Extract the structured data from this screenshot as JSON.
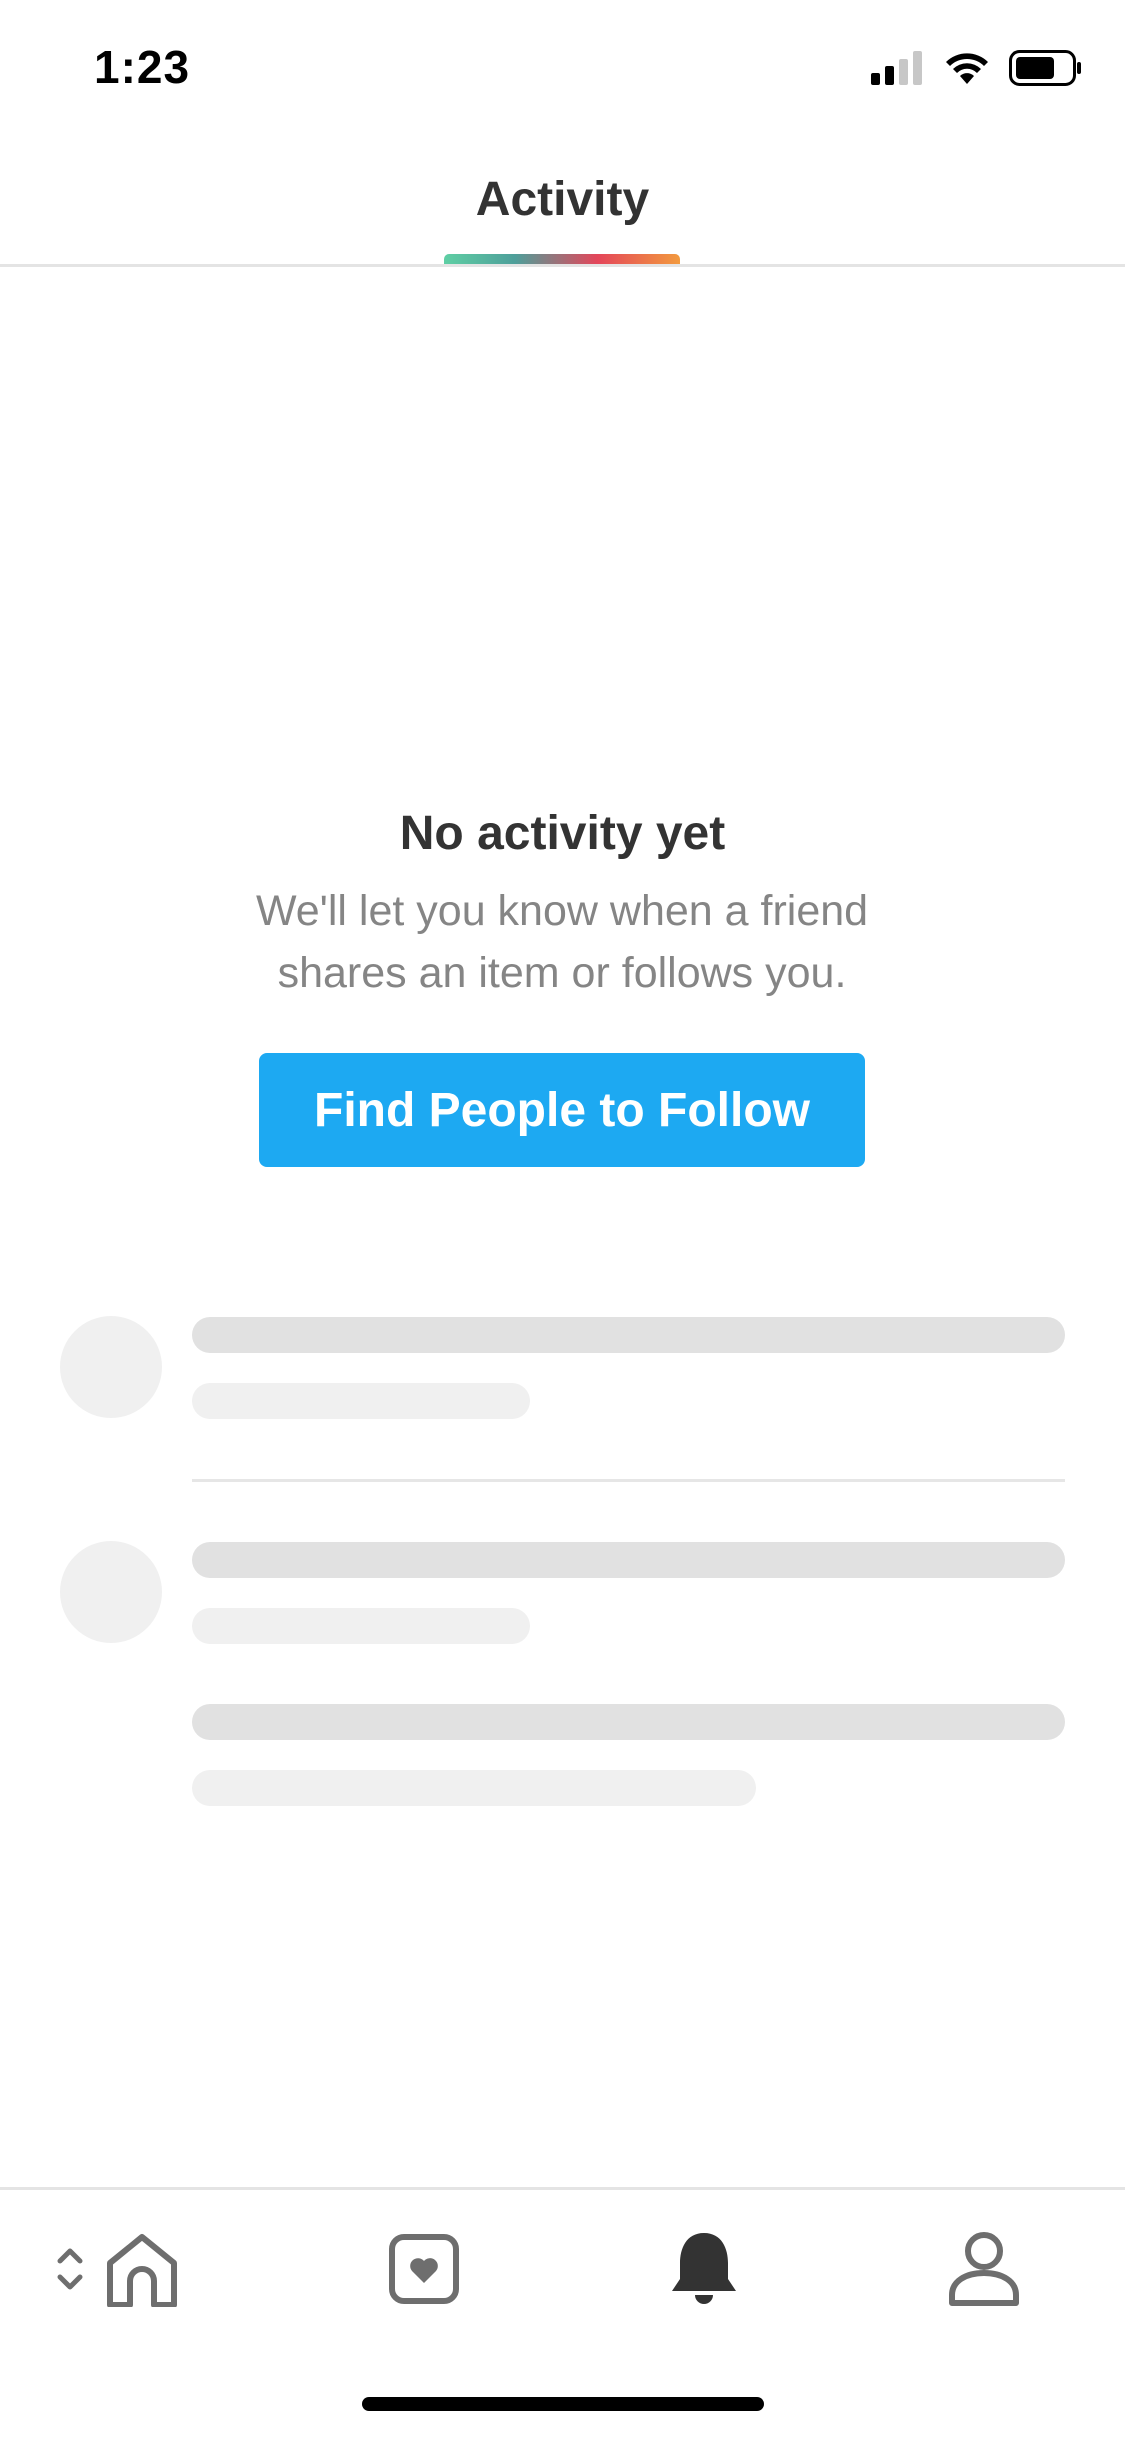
{
  "status_bar": {
    "time": "1:23",
    "icons": [
      "cellular-signal-icon",
      "wifi-icon",
      "battery-icon"
    ]
  },
  "header": {
    "tab_label": "Activity",
    "accent_gradient": [
      "#5fcfa4",
      "#4e9f9a",
      "#e4465a",
      "#f29a3e"
    ]
  },
  "empty_state": {
    "title": "No activity yet",
    "description": "We'll let you know when a friend shares an item or follows you.",
    "button_label": "Find People to Follow",
    "button_color": "#1da9f2"
  },
  "bottom_nav": {
    "items": [
      {
        "icon": "collapse-chevrons-icon",
        "active": false
      },
      {
        "icon": "home-icon",
        "active": false
      },
      {
        "icon": "saved-heart-icon",
        "active": false
      },
      {
        "icon": "bell-icon",
        "active": true
      },
      {
        "icon": "profile-icon",
        "active": false
      }
    ]
  }
}
